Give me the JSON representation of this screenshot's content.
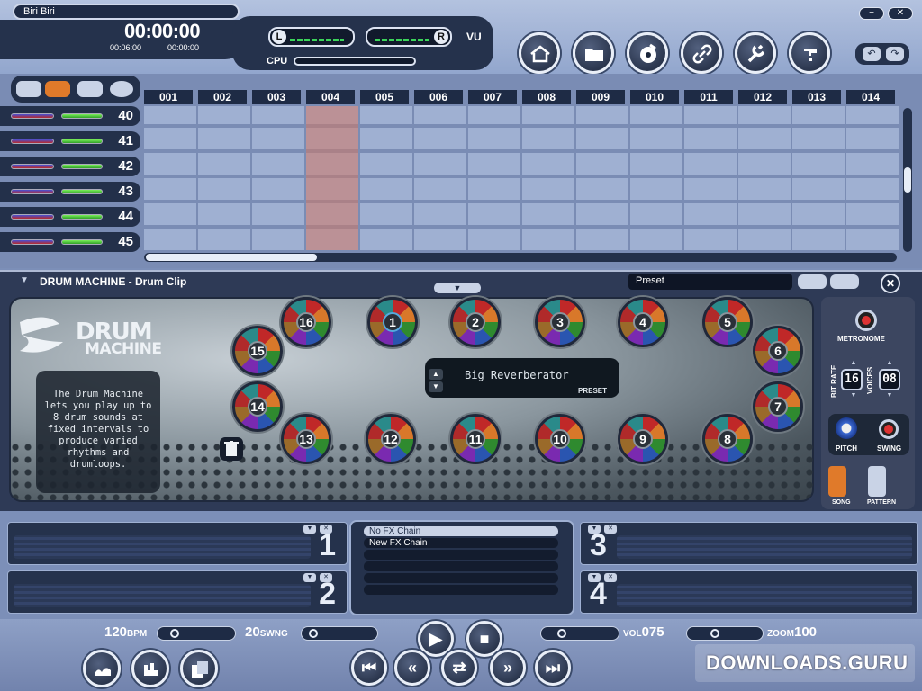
{
  "app": {
    "song_title": "Biri Biri",
    "window_controls": {
      "minimize": "−",
      "close": "✕"
    }
  },
  "transport_display": {
    "time_main": "00:00:00",
    "time_total": "00:06:00",
    "time_secondary": "00:00:00"
  },
  "meters": {
    "left_label": "L",
    "right_label": "R",
    "vu_label": "VU",
    "cpu_label": "CPU"
  },
  "toolbar_icons": [
    "home-import-icon",
    "folder-icon",
    "cd-burn-icon",
    "link-icon",
    "tools-icon",
    "help-icon"
  ],
  "undo_redo": {
    "undo": "↶",
    "redo": "↷"
  },
  "track_header_icons": [
    "keyboard-icon",
    "hand-icon",
    "automation-icon",
    "xfade-icon"
  ],
  "tracks": [
    {
      "number": "40"
    },
    {
      "number": "41"
    },
    {
      "number": "42"
    },
    {
      "number": "43"
    },
    {
      "number": "44"
    },
    {
      "number": "45"
    }
  ],
  "bars": [
    "001",
    "002",
    "003",
    "004",
    "005",
    "006",
    "007",
    "008",
    "009",
    "010",
    "011",
    "012",
    "013",
    "014"
  ],
  "drum_machine": {
    "panel_title": "DRUM MACHINE - Drum Clip",
    "preset_label": "Preset",
    "logo_line1": "DRUM",
    "logo_line2": "MACHINE",
    "description": "The Drum Machine lets you play up to 8 drum sounds at fixed intervals to produce varied rhythms and drumloops.",
    "fx_name": "Big Reverberator",
    "fx_preset_label": "PRESET",
    "pads": [
      "1",
      "2",
      "3",
      "4",
      "5",
      "6",
      "7",
      "8",
      "9",
      "10",
      "11",
      "12",
      "13",
      "14",
      "15",
      "16"
    ],
    "metronome_label": "METRONOME",
    "bit_rate_label": "BIT RATE",
    "bit_rate_value": "16",
    "voices_label": "VOICES",
    "voices_value": "08",
    "pitch_label": "PITCH",
    "swing_label": "SWING",
    "song_label": "SONG",
    "pattern_label": "PATTERN"
  },
  "fx_slots": [
    {
      "number": "1"
    },
    {
      "number": "2"
    },
    {
      "number": "3"
    },
    {
      "number": "4"
    }
  ],
  "fx_chains": [
    {
      "label": "No FX Chain",
      "selected": true
    },
    {
      "label": "New FX Chain",
      "selected": false
    },
    {
      "label": ""
    },
    {
      "label": ""
    },
    {
      "label": ""
    },
    {
      "label": ""
    }
  ],
  "transport": {
    "bpm_value": "120",
    "bpm_unit": "BPM",
    "swing_value": "20",
    "swing_unit": "SWNG",
    "vol_unit": "VOL",
    "vol_value": "075",
    "zoom_unit": "ZOOM",
    "zoom_value": "100"
  },
  "watermark": "DOWNLOADS.GURU",
  "colors": {
    "accent_orange": "#e07a2a",
    "panel_dark": "#25324c",
    "bar_highlight": "#d27864"
  }
}
